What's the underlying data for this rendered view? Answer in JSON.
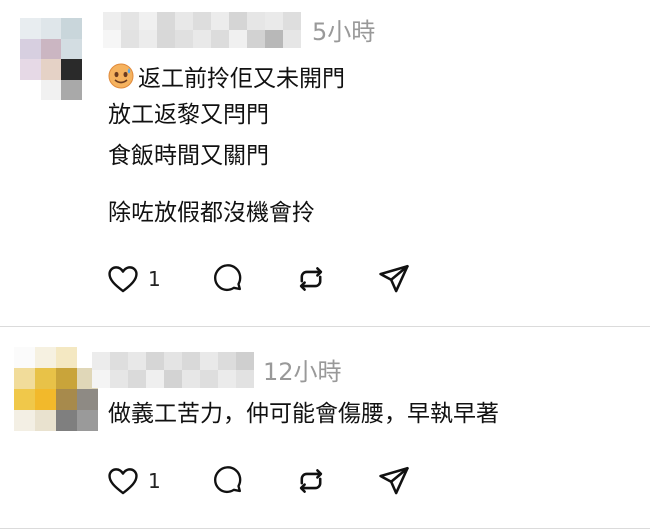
{
  "comments": [
    {
      "time": "5小時",
      "lines": [
        "返工前拎佢又未開門",
        "放工返黎又閂門",
        "食飯時間又關門"
      ],
      "paragraph2": "除咗放假都沒機會拎",
      "emoji_icon": "sweat-smile-emoji-icon",
      "like_count": "1"
    },
    {
      "time": "12小時",
      "lines": [
        "做義工苦力，仲可能會傷腰，早執早著"
      ],
      "like_count": "1"
    }
  ],
  "colors": {
    "timestamp": "#999999",
    "divider": "#dbdbdb",
    "icon": "#111111"
  }
}
